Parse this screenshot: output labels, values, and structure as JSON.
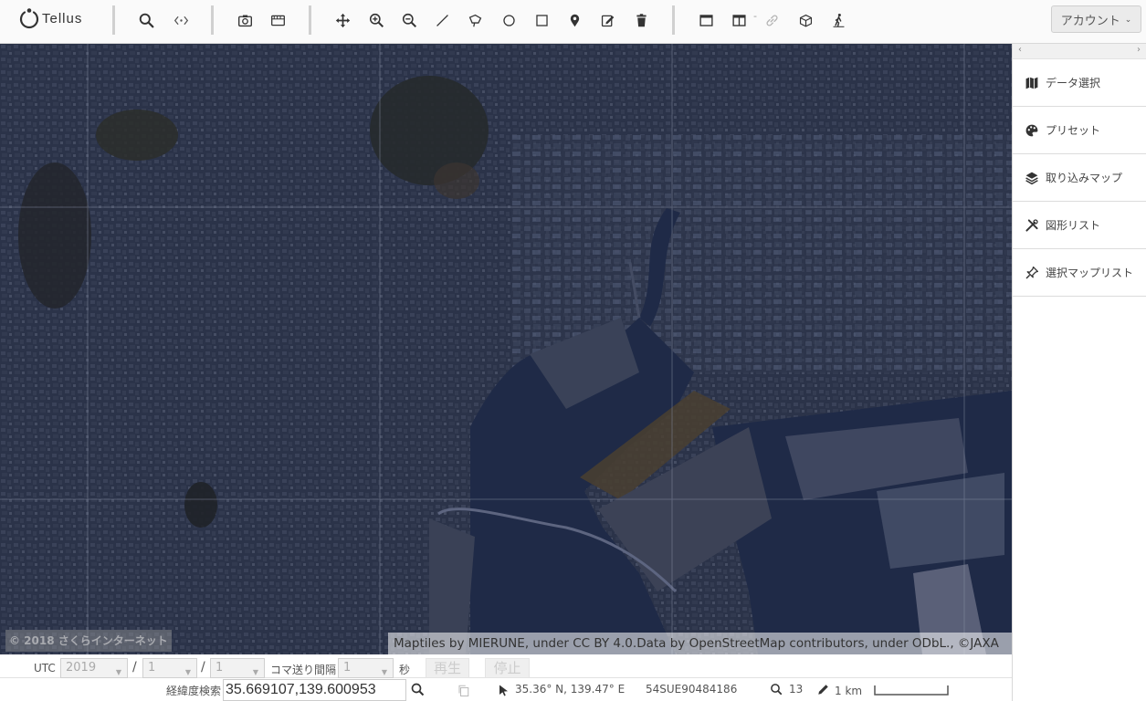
{
  "app": {
    "logo_text": "Tellus",
    "account_label": "アカウント",
    "account_chevron": "⌄"
  },
  "toolbar": {
    "groups": [
      [
        "search-icon",
        "code-brackets-icon"
      ],
      [
        "camera-icon",
        "film-strip-icon"
      ],
      [
        "move-icon",
        "zoom-in-icon",
        "zoom-out-icon",
        "draw-line-icon",
        "draw-polygon-icon",
        "draw-circle-icon",
        "draw-rectangle-icon",
        "map-marker-icon",
        "edit-note-icon",
        "trash-icon"
      ],
      [
        "single-window-icon",
        "split-window-icon",
        "link-icon",
        "cube-3d-icon",
        "pedestrian-icon"
      ]
    ],
    "dash": "-"
  },
  "panel": {
    "scroll_left": "‹",
    "scroll_right": "›",
    "items": [
      {
        "label": "データ選択",
        "icon": "map-icon"
      },
      {
        "label": "プリセット",
        "icon": "palette-icon"
      },
      {
        "label": "取り込みマップ",
        "icon": "layers-icon"
      },
      {
        "label": "図形リスト",
        "icon": "tools-icon"
      },
      {
        "label": "選択マップリスト",
        "icon": "pin-icon"
      }
    ]
  },
  "map": {
    "copyright": "© 2018 さくらインターネット",
    "attribution": "Maptiles by MIERUNE, under CC BY 4.0.Data by OpenStreetMap contributors, under ODbL., ©JAXA",
    "colors": {
      "land": "#2a3247",
      "water": "#1f2a45",
      "grid": "#8b93a8"
    }
  },
  "timebar": {
    "utc_label": "UTC",
    "year": "2019",
    "month": "1",
    "day": "1",
    "slash": "/",
    "interval_label": "コマ送り間隔",
    "interval_value": "1",
    "seconds_label": "秒",
    "play_label": "再生",
    "stop_label": "停止"
  },
  "statusbar": {
    "search_label": "経緯度検索",
    "coord_value": "35.669107,139.600953",
    "cursor_coords": "35.36° N, 139.47° E",
    "mgrs": "54SUE90484186",
    "zoom_level": "13",
    "scale_label": "1 km"
  }
}
